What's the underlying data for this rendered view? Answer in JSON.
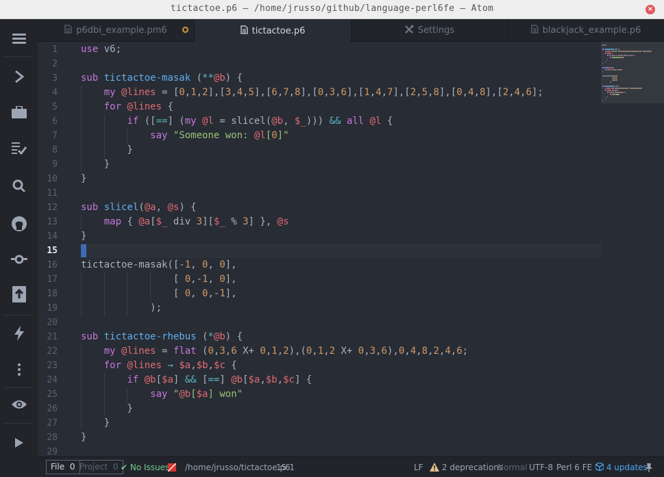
{
  "window": {
    "title": "tictactoe.p6 — /home/jrusso/github/language-perl6fe — Atom",
    "close_glyph": "×"
  },
  "dock": {
    "icons": [
      "menu-icon",
      "chevron-right-icon",
      "briefcase-icon",
      "checklist-icon",
      "search-icon",
      "github-icon",
      "git-commit-icon",
      "package-icon",
      "lightning-icon",
      "more-icon",
      "eye-icon",
      "play-icon"
    ]
  },
  "tabs": [
    {
      "label": "p6dbi_example.pm6",
      "icon": "file-icon",
      "modified": true,
      "active": false
    },
    {
      "label": "tictactoe.p6",
      "icon": "file-icon",
      "modified": false,
      "active": true
    },
    {
      "label": "Settings",
      "icon": "tools-icon",
      "modified": false,
      "active": false
    },
    {
      "label": "blackjack_example.p6",
      "icon": "file-icon",
      "modified": false,
      "active": false
    }
  ],
  "editor": {
    "current_line": 15,
    "line_numbers": [
      "1",
      "2",
      "3",
      "4",
      "5",
      "6",
      "7",
      "8",
      "9",
      "10",
      "11",
      "12",
      "13",
      "14",
      "15",
      "16",
      "17",
      "18",
      "19",
      "20",
      "21",
      "22",
      "23",
      "24",
      "25",
      "26",
      "27",
      "28",
      "29"
    ],
    "lines": [
      [
        [
          "k",
          "use"
        ],
        [
          "p",
          " "
        ],
        [
          "p",
          "v6;"
        ]
      ],
      [],
      [
        [
          "k",
          "sub"
        ],
        [
          "p",
          " "
        ],
        [
          "f",
          "tictactoe-masak"
        ],
        [
          "p",
          " ("
        ],
        [
          "o",
          "**"
        ],
        [
          "v",
          "@b"
        ],
        [
          "p",
          ") {"
        ]
      ],
      [
        [
          "p",
          "    "
        ],
        [
          "k",
          "my"
        ],
        [
          "p",
          " "
        ],
        [
          "v",
          "@lines"
        ],
        [
          "p",
          " = ["
        ],
        [
          "n",
          "0"
        ],
        [
          "p",
          ","
        ],
        [
          "n",
          "1"
        ],
        [
          "p",
          ","
        ],
        [
          "n",
          "2"
        ],
        [
          "p",
          "],["
        ],
        [
          "n",
          "3"
        ],
        [
          "p",
          ","
        ],
        [
          "n",
          "4"
        ],
        [
          "p",
          ","
        ],
        [
          "n",
          "5"
        ],
        [
          "p",
          "],["
        ],
        [
          "n",
          "6"
        ],
        [
          "p",
          ","
        ],
        [
          "n",
          "7"
        ],
        [
          "p",
          ","
        ],
        [
          "n",
          "8"
        ],
        [
          "p",
          "],["
        ],
        [
          "n",
          "0"
        ],
        [
          "p",
          ","
        ],
        [
          "n",
          "3"
        ],
        [
          "p",
          ","
        ],
        [
          "n",
          "6"
        ],
        [
          "p",
          "],["
        ],
        [
          "n",
          "1"
        ],
        [
          "p",
          ","
        ],
        [
          "n",
          "4"
        ],
        [
          "p",
          ","
        ],
        [
          "n",
          "7"
        ],
        [
          "p",
          "],["
        ],
        [
          "n",
          "2"
        ],
        [
          "p",
          ","
        ],
        [
          "n",
          "5"
        ],
        [
          "p",
          ","
        ],
        [
          "n",
          "8"
        ],
        [
          "p",
          "],["
        ],
        [
          "n",
          "0"
        ],
        [
          "p",
          ","
        ],
        [
          "n",
          "4"
        ],
        [
          "p",
          ","
        ],
        [
          "n",
          "8"
        ],
        [
          "p",
          "],["
        ],
        [
          "n",
          "2"
        ],
        [
          "p",
          ","
        ],
        [
          "n",
          "4"
        ],
        [
          "p",
          ","
        ],
        [
          "n",
          "6"
        ],
        [
          "p",
          "];"
        ]
      ],
      [
        [
          "p",
          "    "
        ],
        [
          "k",
          "for"
        ],
        [
          "p",
          " "
        ],
        [
          "v",
          "@lines"
        ],
        [
          "p",
          " {"
        ]
      ],
      [
        [
          "p",
          "        "
        ],
        [
          "k",
          "if"
        ],
        [
          "p",
          " (["
        ],
        [
          "o",
          "=="
        ],
        [
          "p",
          "] ("
        ],
        [
          "k",
          "my"
        ],
        [
          "p",
          " "
        ],
        [
          "v",
          "@l"
        ],
        [
          "p",
          " = slicel("
        ],
        [
          "v",
          "@b"
        ],
        [
          "p",
          ", "
        ],
        [
          "v",
          "$_"
        ],
        [
          "p",
          ")))"
        ],
        [
          "p",
          " "
        ],
        [
          "o",
          "&&"
        ],
        [
          "p",
          " "
        ],
        [
          "k",
          "all"
        ],
        [
          "p",
          " "
        ],
        [
          "v",
          "@l"
        ],
        [
          "p",
          " {"
        ]
      ],
      [
        [
          "p",
          "            "
        ],
        [
          "k",
          "say"
        ],
        [
          "p",
          " "
        ],
        [
          "s",
          "\"Someone won: "
        ],
        [
          "v",
          "@l"
        ],
        [
          "s",
          "["
        ],
        [
          "n",
          "0"
        ],
        [
          "s",
          "]\""
        ]
      ],
      [
        [
          "p",
          "        }"
        ]
      ],
      [
        [
          "p",
          "    }"
        ]
      ],
      [
        [
          "p",
          "}"
        ]
      ],
      [],
      [
        [
          "k",
          "sub"
        ],
        [
          "p",
          " "
        ],
        [
          "f",
          "slicel"
        ],
        [
          "p",
          "("
        ],
        [
          "v",
          "@a"
        ],
        [
          "p",
          ", "
        ],
        [
          "v",
          "@s"
        ],
        [
          "p",
          ") {"
        ]
      ],
      [
        [
          "p",
          "    "
        ],
        [
          "k",
          "map"
        ],
        [
          "p",
          " { "
        ],
        [
          "v",
          "@a"
        ],
        [
          "p",
          "["
        ],
        [
          "v",
          "$_"
        ],
        [
          "p",
          " div "
        ],
        [
          "n",
          "3"
        ],
        [
          "p",
          "]["
        ],
        [
          "v",
          "$_"
        ],
        [
          "p",
          " % "
        ],
        [
          "n",
          "3"
        ],
        [
          "p",
          "] }, "
        ],
        [
          "v",
          "@s"
        ]
      ],
      [
        [
          "p",
          "}"
        ]
      ],
      [],
      [
        [
          "p",
          "tictactoe-masak([-"
        ],
        [
          "n",
          "1"
        ],
        [
          "p",
          ", "
        ],
        [
          "n",
          "0"
        ],
        [
          "p",
          ", "
        ],
        [
          "n",
          "0"
        ],
        [
          "p",
          "],"
        ]
      ],
      [
        [
          "p",
          "                [ "
        ],
        [
          "n",
          "0"
        ],
        [
          "p",
          ",-"
        ],
        [
          "n",
          "1"
        ],
        [
          "p",
          ", "
        ],
        [
          "n",
          "0"
        ],
        [
          "p",
          "],"
        ]
      ],
      [
        [
          "p",
          "                [ "
        ],
        [
          "n",
          "0"
        ],
        [
          "p",
          ", "
        ],
        [
          "n",
          "0"
        ],
        [
          "p",
          ",-"
        ],
        [
          "n",
          "1"
        ],
        [
          "p",
          "],"
        ]
      ],
      [
        [
          "p",
          "            );"
        ]
      ],
      [],
      [
        [
          "k",
          "sub"
        ],
        [
          "p",
          " "
        ],
        [
          "f",
          "tictactoe-rhebus"
        ],
        [
          "p",
          " ("
        ],
        [
          "o",
          "*"
        ],
        [
          "v",
          "@b"
        ],
        [
          "p",
          ") {"
        ]
      ],
      [
        [
          "p",
          "    "
        ],
        [
          "k",
          "my"
        ],
        [
          "p",
          " "
        ],
        [
          "v",
          "@lines"
        ],
        [
          "p",
          " = "
        ],
        [
          "k",
          "flat"
        ],
        [
          "p",
          " ("
        ],
        [
          "n",
          "0"
        ],
        [
          "p",
          ","
        ],
        [
          "n",
          "3"
        ],
        [
          "p",
          ","
        ],
        [
          "n",
          "6"
        ],
        [
          "p",
          " X+ "
        ],
        [
          "n",
          "0"
        ],
        [
          "p",
          ","
        ],
        [
          "n",
          "1"
        ],
        [
          "p",
          ","
        ],
        [
          "n",
          "2"
        ],
        [
          "p",
          "),("
        ],
        [
          "n",
          "0"
        ],
        [
          "p",
          ","
        ],
        [
          "n",
          "1"
        ],
        [
          "p",
          ","
        ],
        [
          "n",
          "2"
        ],
        [
          "p",
          " X+ "
        ],
        [
          "n",
          "0"
        ],
        [
          "p",
          ","
        ],
        [
          "n",
          "3"
        ],
        [
          "p",
          ","
        ],
        [
          "n",
          "6"
        ],
        [
          "p",
          "),"
        ],
        [
          "n",
          "0"
        ],
        [
          "p",
          ","
        ],
        [
          "n",
          "4"
        ],
        [
          "p",
          ","
        ],
        [
          "n",
          "8"
        ],
        [
          "p",
          ","
        ],
        [
          "n",
          "2"
        ],
        [
          "p",
          ","
        ],
        [
          "n",
          "4"
        ],
        [
          "p",
          ","
        ],
        [
          "n",
          "6"
        ],
        [
          "p",
          ";"
        ]
      ],
      [
        [
          "p",
          "    "
        ],
        [
          "k",
          "for"
        ],
        [
          "p",
          " "
        ],
        [
          "v",
          "@lines"
        ],
        [
          "p",
          " "
        ],
        [
          "o",
          "→"
        ],
        [
          "p",
          " "
        ],
        [
          "v",
          "$a"
        ],
        [
          "p",
          ","
        ],
        [
          "v",
          "$b"
        ],
        [
          "p",
          ","
        ],
        [
          "v",
          "$c"
        ],
        [
          "p",
          " {"
        ]
      ],
      [
        [
          "p",
          "        "
        ],
        [
          "k",
          "if"
        ],
        [
          "p",
          " "
        ],
        [
          "v",
          "@b"
        ],
        [
          "p",
          "["
        ],
        [
          "v",
          "$a"
        ],
        [
          "p",
          "] "
        ],
        [
          "o",
          "&&"
        ],
        [
          "p",
          " ["
        ],
        [
          "o",
          "=="
        ],
        [
          "p",
          "] "
        ],
        [
          "v",
          "@b"
        ],
        [
          "p",
          "["
        ],
        [
          "v",
          "$a"
        ],
        [
          "p",
          ","
        ],
        [
          "v",
          "$b"
        ],
        [
          "p",
          ","
        ],
        [
          "v",
          "$c"
        ],
        [
          "p",
          "] {"
        ]
      ],
      [
        [
          "p",
          "            "
        ],
        [
          "k",
          "say"
        ],
        [
          "p",
          " "
        ],
        [
          "s",
          "\""
        ],
        [
          "v",
          "@b"
        ],
        [
          "s",
          "["
        ],
        [
          "v",
          "$a"
        ],
        [
          "s",
          "] won\""
        ]
      ],
      [
        [
          "p",
          "        }"
        ]
      ],
      [
        [
          "p",
          "    }"
        ]
      ],
      [
        [
          "p",
          "}"
        ]
      ],
      []
    ]
  },
  "status": {
    "file_label": "File",
    "file_count": "0",
    "project_label": "Project",
    "project_count": "0",
    "issues": "No Issues",
    "path": "/home/jrusso/tictactoe.p6",
    "cursor_position": "15:1",
    "line_ending": "LF",
    "deprecations": "2 deprecations",
    "mode": "Normal",
    "encoding": "UTF-8",
    "grammar": "Perl 6 FE",
    "updates": "4 updates"
  },
  "colors": {
    "keyword": "#c678dd",
    "function": "#61afef",
    "variable": "#e06c75",
    "number": "#d19a66",
    "string": "#98c379",
    "operator": "#56b6c2",
    "cursor": "#3e6cb4",
    "ok_green": "#73c990",
    "warning_yellow": "#e2c08d",
    "link_blue": "#4aa5f0"
  }
}
